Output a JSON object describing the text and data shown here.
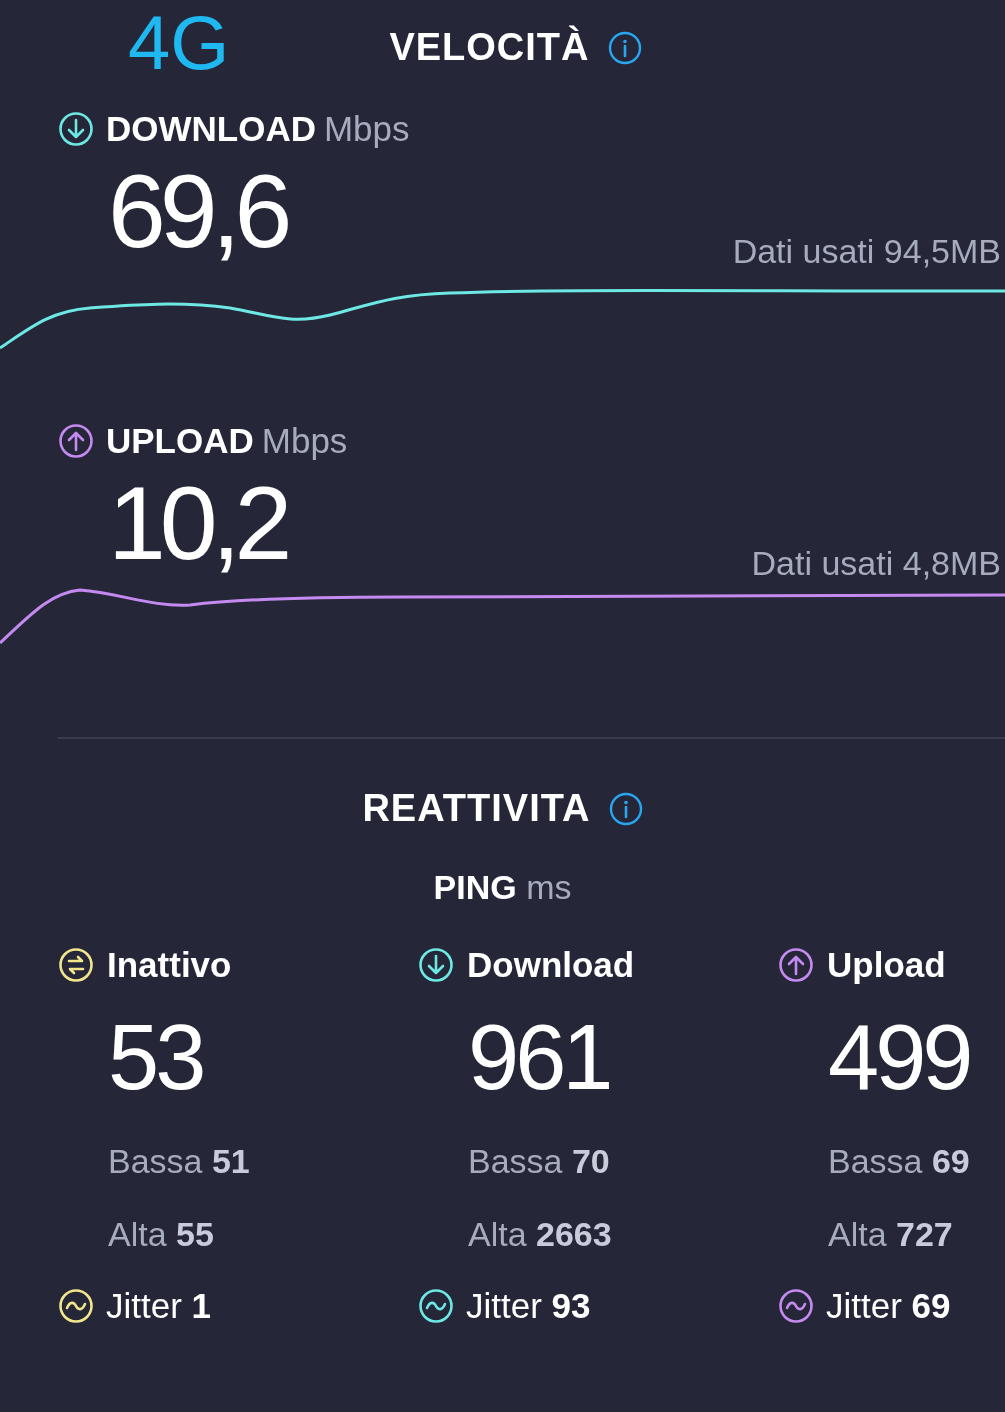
{
  "network": "4G",
  "speed": {
    "title": "VELOCITÀ"
  },
  "tests": [
    {
      "kind": "download",
      "label": "DOWNLOAD",
      "unit": "Mbps",
      "value": "69,6",
      "data_used": "Dati usati 94,5MB",
      "color": "#6ee8e4"
    },
    {
      "kind": "upload",
      "label": "UPLOAD",
      "unit": "Mbps",
      "value": "10,2",
      "data_used": "Dati usati 4,8MB",
      "color": "#c58af0"
    }
  ],
  "responsiveness": {
    "title": "REATTIVITA",
    "ping_label": "PING",
    "ping_unit": "ms",
    "columns": [
      {
        "kind": "idle",
        "label": "Inattivo",
        "value": "53",
        "low_label": "Bassa",
        "low": "51",
        "high_label": "Alta",
        "high": "55",
        "jitter_label": "Jitter",
        "jitter": "1",
        "color": "#f2e68c"
      },
      {
        "kind": "download",
        "label": "Download",
        "value": "961",
        "low_label": "Bassa",
        "low": "70",
        "high_label": "Alta",
        "high": "2663",
        "jitter_label": "Jitter",
        "jitter": "93",
        "color": "#6ee8e4"
      },
      {
        "kind": "upload",
        "label": "Upload",
        "value": "499",
        "low_label": "Bassa",
        "low": "69",
        "high_label": "Alta",
        "high": "727",
        "jitter_label": "Jitter",
        "jitter": "69",
        "color": "#c58af0"
      }
    ]
  }
}
